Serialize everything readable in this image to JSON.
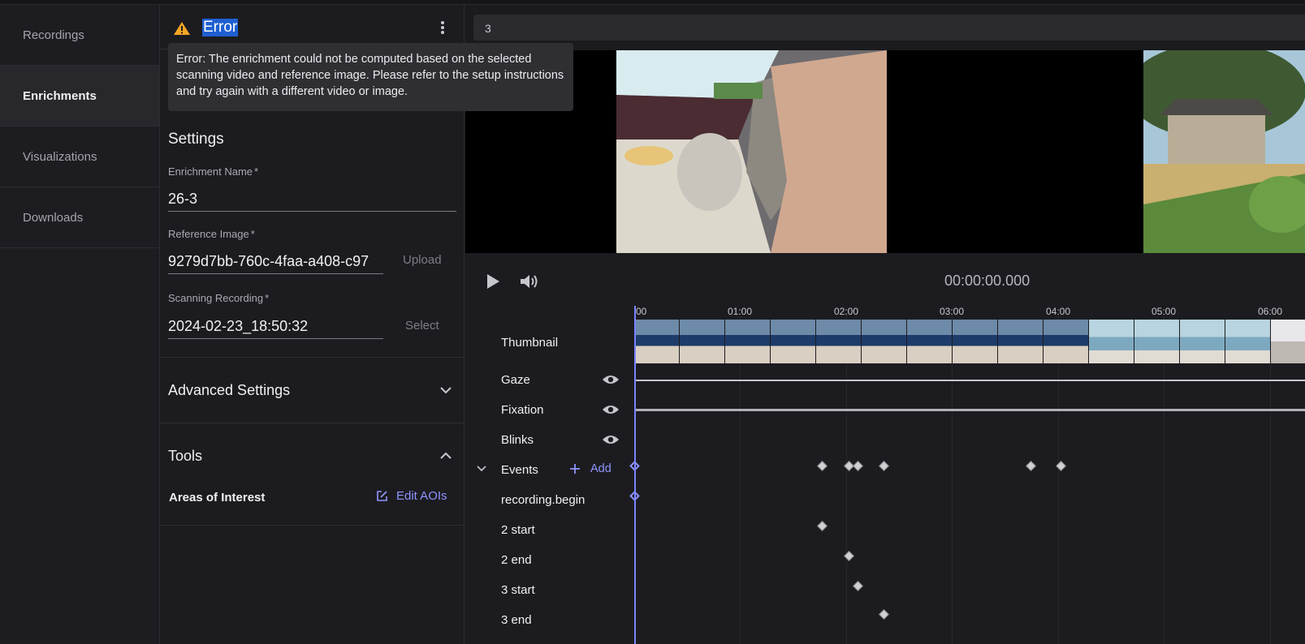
{
  "nav": {
    "items": [
      {
        "label": "Recordings",
        "active": false
      },
      {
        "label": "Enrichments",
        "active": true
      },
      {
        "label": "Visualizations",
        "active": false
      },
      {
        "label": "Downloads",
        "active": false
      }
    ]
  },
  "panel": {
    "error_title": "Error",
    "error_tooltip": "Error: The enrichment could not be computed based on the selected scanning video and reference image. Please refer to the setup instructions and try again with a different video or image.",
    "settings_title": "Settings",
    "enrichment_name_label": "Enrichment Name",
    "enrichment_name_value": "26-3",
    "reference_image_label": "Reference Image",
    "reference_image_value": "9279d7bb-760c-4faa-a408-c97",
    "upload_label": "Upload",
    "scanning_recording_label": "Scanning Recording",
    "scanning_recording_value": "2024-02-23_18:50:32",
    "select_label": "Select",
    "required_mark": "*",
    "advanced_settings_label": "Advanced Settings",
    "tools_label": "Tools",
    "aoi_label": "Areas of Interest",
    "edit_aois_label": "Edit AOIs"
  },
  "search": {
    "value": "3"
  },
  "player": {
    "time": "00:00:00.000"
  },
  "timeline": {
    "ticks": [
      "00",
      "01:00",
      "02:00",
      "03:00",
      "04:00",
      "05:00",
      "06:00"
    ],
    "tracks": [
      "Thumbnail",
      "Gaze",
      "Fixation",
      "Blinks",
      "Events",
      "recording.begin",
      "2 start",
      "2 end",
      "3 start",
      "3 end"
    ],
    "add_label": "Add"
  },
  "colors": {
    "accent": "#8f95ff",
    "warning": "#f5a623",
    "selection": "#1f5fd1"
  }
}
